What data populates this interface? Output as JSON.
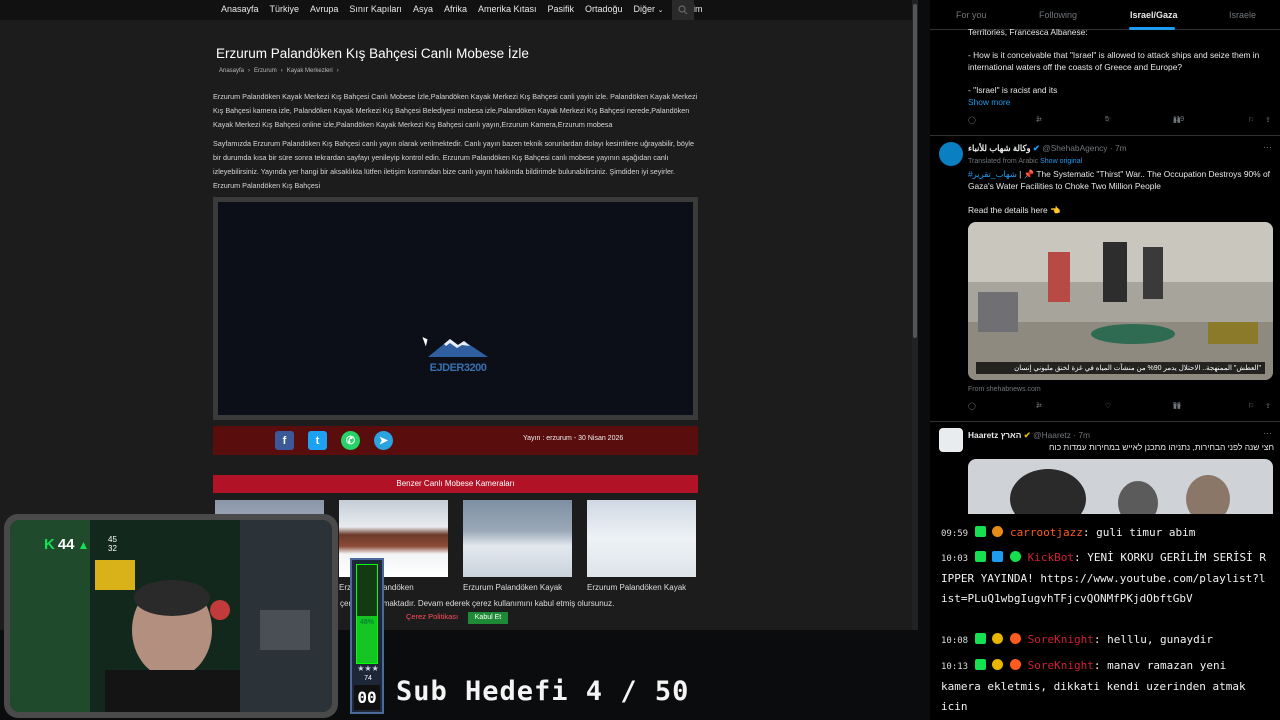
{
  "browser": {
    "nav_items": [
      "Anasayfa",
      "Türkiye",
      "Avrupa",
      "Sınır Kapıları",
      "Asya",
      "Afrika",
      "Amerika Kıtası",
      "Pasifik",
      "Ortadoğu",
      "Diğer",
      "İletişim"
    ],
    "page_title": "Erzurum Palandöken Kış Bahçesi Canlı Mobese İzle",
    "breadcrumb": [
      "Anasayfa",
      "Erzurum",
      "Kayak Merkezleri"
    ],
    "description_1": "Erzurum Palandöken Kayak Merkezi Kış Bahçesi Canlı Mobese İzle,Palandöken Kayak Merkezi Kış Bahçesi canli yayin izle. Palandöken Kayak Merkezi Kış Bahçesi kamera izle, Palandöken Kayak Merkezi Kış Bahçesi Belediyesi mobesa izle,Palandöken Kayak Merkezi Kış Bahçesi nerede,Palandöken Kayak Merkezi Kış Bahçesi online izle,Palandöken Kayak Merkezi Kış Bahçesi canlı yayın,Erzurum Kamera,Erzurum mobesa",
    "description_2": "Sayfamızda Erzurum Palandöken Kış Bahçesi canlı yayın olarak verilmektedir. Canlı yayın bazen teknik sorunlardan dolayı kesintilere uğrayabilir, böyle bir durumda kısa bir süre sonra tekrardan sayfayı yenileyip kontrol edin. Erzurum Palandöken Kış Bahçesi canlı mobese yayının aşağıdan canlı izleyebilirsiniz. Yayında yer hangi bir aksaklıkta lütfen iletişim kısmından bize canlı yayın hakkında bildirimde bulunabilirsiniz. Şimdiden iyi seyirler. Erzurum Palandöken Kış Bahçesi",
    "player_logo": "EJDER3200",
    "share_icons": [
      "facebook-icon",
      "twitter-icon",
      "whatsapp-icon",
      "telegram-icon"
    ],
    "broadcast_date": "Yayın : erzurum - 30 Nisan 2026",
    "similar_header": "Benzer Canlı Mobese Kameraları",
    "thumbnails": [
      {
        "caption": ""
      },
      {
        "caption": "Erzurum Palandöken"
      },
      {
        "caption": "Erzurum Palandöken Kayak"
      },
      {
        "caption": "Erzurum Palandöken Kayak"
      }
    ],
    "cookie_text": "çerez kullanmaktadır. Devam ederek çerez kullanımını kabul etmiş olursunuz.",
    "cookie_policy": "Çerez Politikası",
    "cookie_accept": "Kabul Et"
  },
  "twitter": {
    "tabs": [
      "For you",
      "Following",
      "Israel/Gaza",
      "Israele"
    ],
    "active_tab": "Israel/Gaza",
    "tweet1": {
      "line_a": "Territories, Francesca Albanese:",
      "line_b": "- How is it conceivable that \"Israel\" is allowed to attack ships and seize them in international waters off the coasts of Greece and Europe?",
      "line_c": "- \"Israel\" is racist and its",
      "show_more": "Show more",
      "retweets": "1",
      "likes": "5",
      "views": "119"
    },
    "tweet2": {
      "name": "وكالة شهاب للأنباء",
      "handle": "@ShehabAgency · 7m",
      "translated": "Translated from Arabic",
      "show_original": "Show original",
      "hashtag": "#شهاب_تقرير",
      "text": "| 📌 The Systematic \"Thirst\" War.. The Occupation Destroys 90% of Gaza's Water Facilities to Choke Two Million People",
      "read_more": "Read the details here 👈",
      "image_caption": "\"العطش\" الممنهجة.. الاحتلال يدمر 90% من منشآت المياه في غزة لخنق مليوني إنسان",
      "source": "From shehabnews.com",
      "retweets": "1",
      "views": "93"
    },
    "tweet3": {
      "name": "Haaretz הארץ",
      "handle": "@Haaretz · 7m",
      "text": "חצי שנה לפני הבחירות, נתניהו מתכנן לאייש במחירות עמדות כוח"
    }
  },
  "chat": [
    {
      "time": "09:59",
      "user": "carrootjazz",
      "message": "guli timur abim"
    },
    {
      "time": "10:03",
      "user": "KickBot",
      "message": "YENİ KORKU GERİLİM SERİSİ RIPPER YAYINDA! https://www.youtube.com/playlist?list=PLuQ1wbgIugvhTFjcvQONMfPKjdObftGbV"
    },
    {
      "time": "10:08",
      "user": "SoreKnight",
      "message": "helllu, gunaydir"
    },
    {
      "time": "10:13",
      "user": "SoreKnight",
      "message": "manav ramazan yeni kamera ekletmis, dikkati kendi uzerinden atmak icin"
    }
  ],
  "stream": {
    "kills": "44",
    "kd_top": "45",
    "kd_bottom": "32",
    "progress_percent": 48,
    "progress_label": "48%",
    "level": "74",
    "counter": "00",
    "sub_goal": "Sub Hedefi 4 / 50"
  },
  "colors": {
    "accent_red": "#b11226",
    "share_bar": "#5a0d0d",
    "twitter_blue": "#1d9bf0",
    "chat_green": "#14e050"
  }
}
